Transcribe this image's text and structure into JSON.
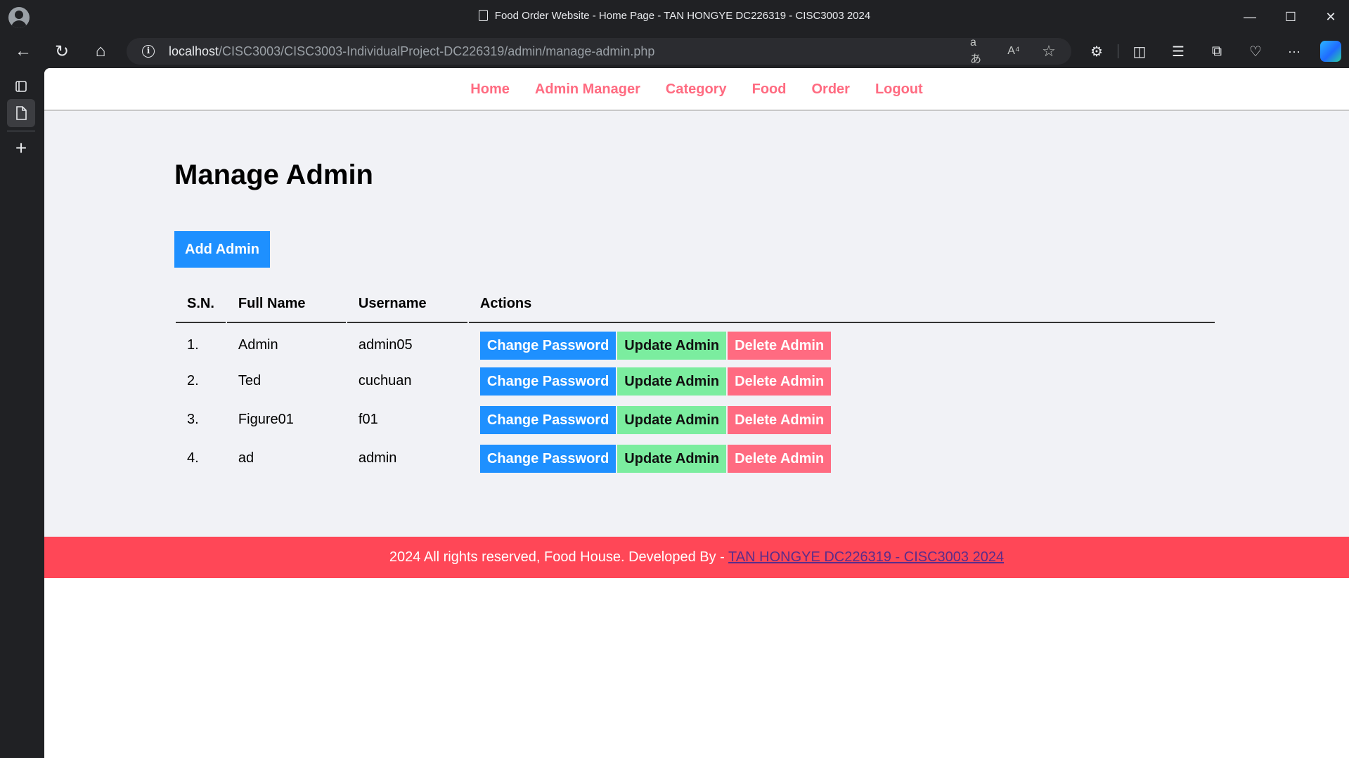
{
  "window": {
    "title": "Food Order Website - Home Page - TAN HONGYE DC226319 - CISC3003 2024",
    "minimize_glyph": "—",
    "maximize_glyph": "☐",
    "close_glyph": "✕"
  },
  "address_bar": {
    "host": "localhost",
    "path": "/CISC3003/CISC3003-IndividualProject-DC226319/admin/manage-admin.php"
  },
  "icons": {
    "back": "←",
    "refresh": "↻",
    "home": "⌂",
    "info": "i",
    "translate": "aあ",
    "read_aloud": "A⁴",
    "favorite": "☆",
    "extensions": "⚙",
    "split": "◫",
    "favorites_list": "☰",
    "collections": "⧉",
    "performance": "♡",
    "more": "···",
    "new_tab": "+"
  },
  "nav": {
    "items": [
      {
        "label": "Home"
      },
      {
        "label": "Admin Manager"
      },
      {
        "label": "Category"
      },
      {
        "label": "Food"
      },
      {
        "label": "Order"
      },
      {
        "label": "Logout"
      }
    ]
  },
  "main": {
    "title": "Manage Admin",
    "add_button": "Add Admin",
    "table": {
      "headers": [
        "S.N.",
        "Full Name",
        "Username",
        "Actions"
      ],
      "rows": [
        {
          "sn": "1.",
          "full_name": "Admin",
          "username": "admin05"
        },
        {
          "sn": "2.",
          "full_name": "Ted",
          "username": "cuchuan"
        },
        {
          "sn": "3.",
          "full_name": "Figure01",
          "username": "f01"
        },
        {
          "sn": "4.",
          "full_name": "ad",
          "username": "admin"
        }
      ],
      "actions": {
        "change_password": "Change Password",
        "update": "Update Admin",
        "delete": "Delete Admin"
      }
    }
  },
  "footer": {
    "text": "2024 All rights reserved, Food House. Developed By - ",
    "link": "TAN HONGYE DC226319 - CISC3003 2024"
  },
  "colors": {
    "nav_link": "#ff6b81",
    "primary": "#1e90ff",
    "secondary": "#7bed9f",
    "danger": "#ff6b81",
    "footer_bg": "#ff4757",
    "main_bg": "#f1f2f6"
  }
}
